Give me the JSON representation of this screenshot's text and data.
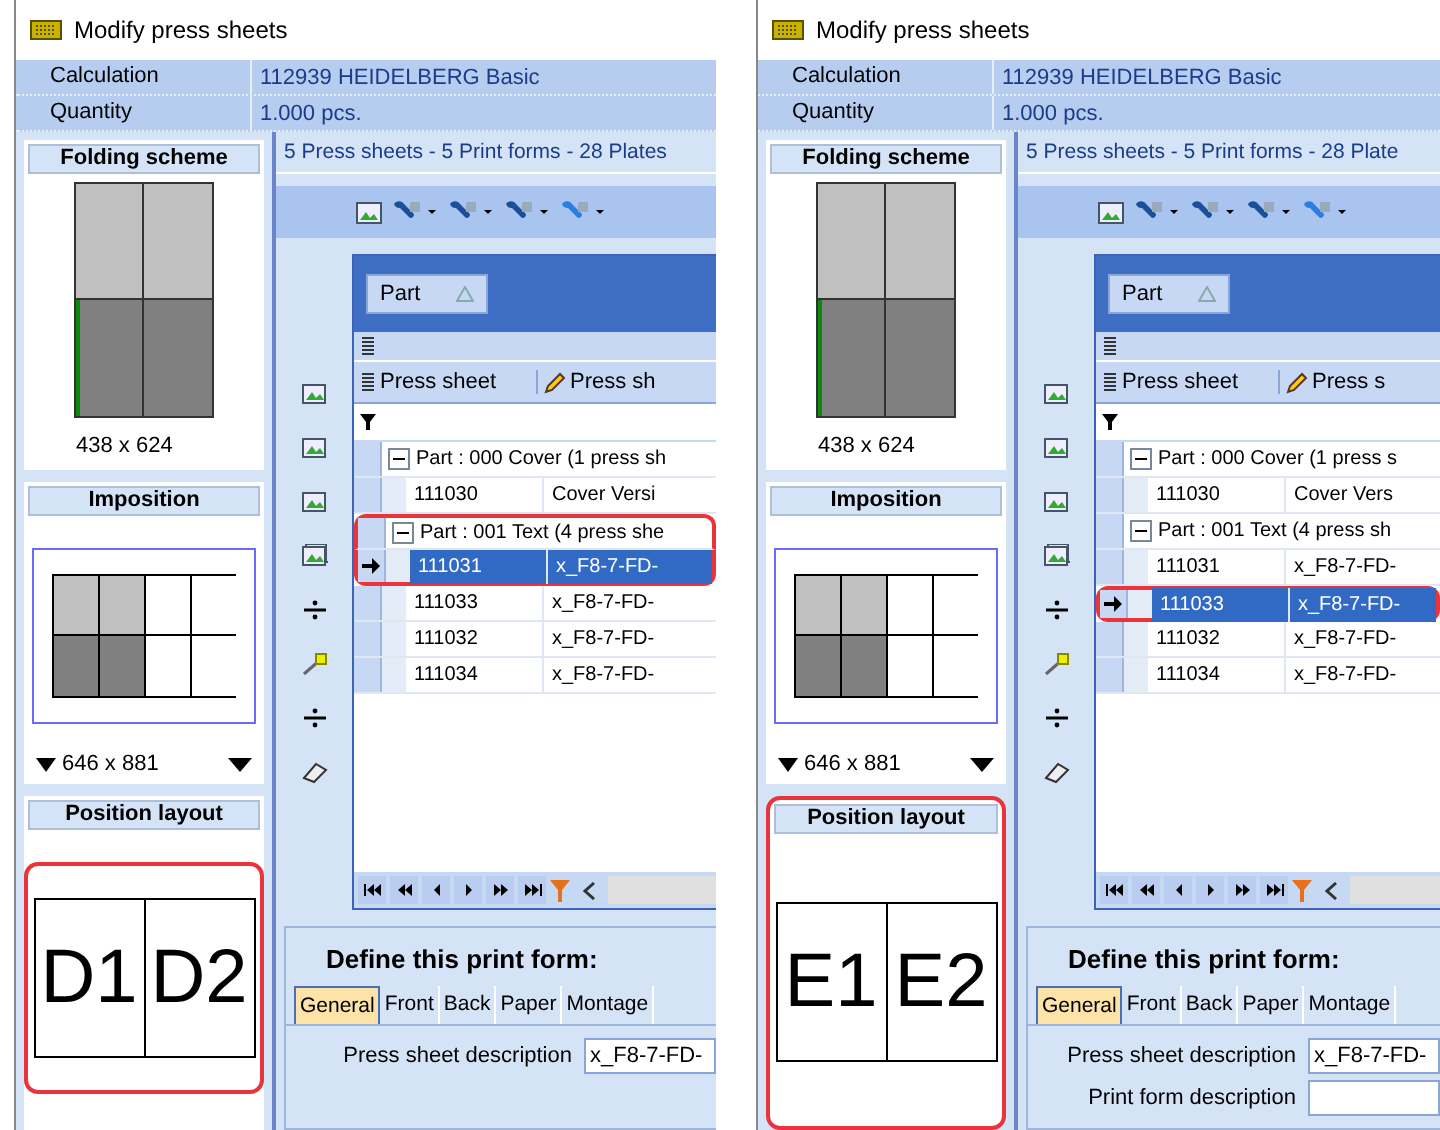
{
  "panels": [
    {
      "window": {
        "title": "Modify press sheets"
      },
      "info": [
        {
          "label": "Calculation",
          "value": "112939 HEIDELBERG Basic"
        },
        {
          "label": "Quantity",
          "value": "1.000 pcs."
        }
      ],
      "folding_scheme": {
        "title": "Folding scheme",
        "size": "438 x 624"
      },
      "imposition": {
        "title": "Imposition",
        "size": "646 x 881"
      },
      "position_layout": {
        "title": "Position layout",
        "highlight_drawing": true,
        "highlight_section": false,
        "pages": [
          "D1",
          "D2"
        ]
      },
      "summary": "5 Press sheets - 5 Print forms - 28 Plates",
      "grid": {
        "group_by": "Part",
        "columns": [
          "Press sheet",
          "Press sh"
        ],
        "rows": [
          {
            "kind": "group",
            "text": "Part : 000 Cover (1 press sh",
            "expanded": true,
            "highlighted": false
          },
          {
            "kind": "row",
            "cells": [
              "111030",
              "Cover Versi"
            ],
            "selected": false,
            "highlighted": false
          },
          {
            "kind": "group",
            "text": "Part : 001 Text (4 press she",
            "expanded": true,
            "highlighted": true
          },
          {
            "kind": "row",
            "cells": [
              "111031",
              "x_F8-7-FD-"
            ],
            "selected": true,
            "highlighted": true
          },
          {
            "kind": "row",
            "cells": [
              "111033",
              "x_F8-7-FD-"
            ],
            "selected": false,
            "highlighted": false
          },
          {
            "kind": "row",
            "cells": [
              "111032",
              "x_F8-7-FD-"
            ],
            "selected": false,
            "highlighted": false
          },
          {
            "kind": "row",
            "cells": [
              "111034",
              "x_F8-7-FD-"
            ],
            "selected": false,
            "highlighted": false
          }
        ]
      },
      "form": {
        "title": "Define this print form:",
        "tabs": [
          {
            "label": "General",
            "selected": true
          },
          {
            "label": "Front",
            "selected": false
          },
          {
            "label": "Back",
            "selected": false
          },
          {
            "label": "Paper",
            "selected": false
          },
          {
            "label": "Montage",
            "selected": false
          }
        ],
        "fields": [
          {
            "label": "Press sheet description",
            "value": "x_F8-7-FD-"
          }
        ]
      }
    },
    {
      "window": {
        "title": "Modify press sheets"
      },
      "info": [
        {
          "label": "Calculation",
          "value": "112939 HEIDELBERG Basic"
        },
        {
          "label": "Quantity",
          "value": "1.000 pcs."
        }
      ],
      "folding_scheme": {
        "title": "Folding scheme",
        "size": "438 x 624"
      },
      "imposition": {
        "title": "Imposition",
        "size": "646 x 881"
      },
      "position_layout": {
        "title": "Position layout",
        "highlight_drawing": false,
        "highlight_section": true,
        "pages": [
          "E1",
          "E2"
        ]
      },
      "summary": "5 Press sheets - 5 Print forms - 28 Plate",
      "grid": {
        "group_by": "Part",
        "columns": [
          "Press sheet",
          "Press s"
        ],
        "rows": [
          {
            "kind": "group",
            "text": "Part : 000 Cover (1 press s",
            "expanded": true,
            "highlighted": false
          },
          {
            "kind": "row",
            "cells": [
              "111030",
              "Cover Vers"
            ],
            "selected": false,
            "highlighted": false
          },
          {
            "kind": "group",
            "text": "Part : 001 Text (4 press sh",
            "expanded": true,
            "highlighted": false
          },
          {
            "kind": "row",
            "cells": [
              "111031",
              "x_F8-7-FD-"
            ],
            "selected": false,
            "highlighted": false
          },
          {
            "kind": "row",
            "cells": [
              "111033",
              "x_F8-7-FD-"
            ],
            "selected": true,
            "highlighted": true
          },
          {
            "kind": "row",
            "cells": [
              "111032",
              "x_F8-7-FD-"
            ],
            "selected": false,
            "highlighted": false
          },
          {
            "kind": "row",
            "cells": [
              "111034",
              "x_F8-7-FD-"
            ],
            "selected": false,
            "highlighted": false
          }
        ]
      },
      "form": {
        "title": "Define this print form:",
        "tabs": [
          {
            "label": "General",
            "selected": true
          },
          {
            "label": "Front",
            "selected": false
          },
          {
            "label": "Back",
            "selected": false
          },
          {
            "label": "Paper",
            "selected": false
          },
          {
            "label": "Montage",
            "selected": false
          }
        ],
        "fields": [
          {
            "label": "Press sheet description",
            "value": "x_F8-7-FD-"
          },
          {
            "label": "Print form description"
          }
        ]
      }
    }
  ]
}
